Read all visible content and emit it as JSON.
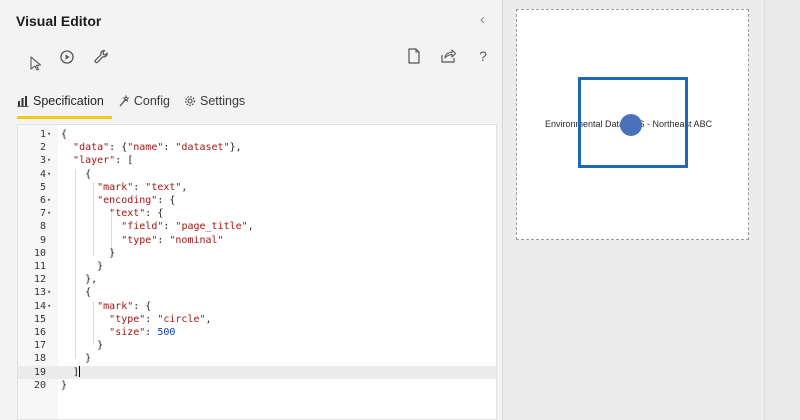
{
  "panel": {
    "title": "Visual Editor",
    "collapse_glyph": "‹"
  },
  "toolbar": {
    "left_icons": [
      "play-icon",
      "run-icon",
      "wrench-icon"
    ],
    "right_icons": [
      "new-file-icon",
      "share-icon",
      "help-icon"
    ],
    "help_glyph": "?"
  },
  "tabs": [
    {
      "label": "Specification",
      "icon": "bar-chart-icon",
      "active": true
    },
    {
      "label": "Config",
      "icon": "wand-icon",
      "active": false
    },
    {
      "label": "Settings",
      "icon": "gear-icon",
      "active": false
    }
  ],
  "editor": {
    "cursor_line": 19,
    "lines": [
      {
        "num": "1",
        "fold": "▾",
        "html": "{"
      },
      {
        "num": "2",
        "fold": "",
        "html": "  <span class='s'>\"data\"</span>: {<span class='s'>\"name\"</span>: <span class='s'>\"dataset\"</span>},"
      },
      {
        "num": "3",
        "fold": "▾",
        "html": "  <span class='s'>\"layer\"</span>: ["
      },
      {
        "num": "4",
        "fold": "▾",
        "html": "    {"
      },
      {
        "num": "5",
        "fold": "",
        "html": "      <span class='s'>\"mark\"</span>: <span class='s'>\"text\"</span>,"
      },
      {
        "num": "6",
        "fold": "▾",
        "html": "      <span class='s'>\"encoding\"</span>: {"
      },
      {
        "num": "7",
        "fold": "▾",
        "html": "        <span class='s'>\"text\"</span>: {"
      },
      {
        "num": "8",
        "fold": "",
        "html": "          <span class='s'>\"field\"</span>: <span class='s'>\"page_title\"</span>,"
      },
      {
        "num": "9",
        "fold": "",
        "html": "          <span class='s'>\"type\"</span>: <span class='s'>\"nominal\"</span>"
      },
      {
        "num": "10",
        "fold": "",
        "html": "        }"
      },
      {
        "num": "11",
        "fold": "",
        "html": "      }"
      },
      {
        "num": "12",
        "fold": "",
        "html": "    },"
      },
      {
        "num": "13",
        "fold": "▾",
        "html": "    {"
      },
      {
        "num": "14",
        "fold": "▾",
        "html": "      <span class='s'>\"mark\"</span>: {"
      },
      {
        "num": "15",
        "fold": "",
        "html": "        <span class='s'>\"type\"</span>: <span class='s'>\"circle\"</span>,"
      },
      {
        "num": "16",
        "fold": "",
        "html": "        <span class='s'>\"size\"</span>: <span class='n'>500</span>"
      },
      {
        "num": "17",
        "fold": "",
        "html": "      }"
      },
      {
        "num": "18",
        "fold": "",
        "html": "    }"
      },
      {
        "num": "19",
        "fold": "",
        "html": "  ]<span class='cursor'></span>"
      },
      {
        "num": "20",
        "fold": "",
        "html": "}"
      }
    ]
  },
  "preview": {
    "text": "Environmental Data - US - Northeast ABC",
    "circle_color": "#4a72ba",
    "highlight_color": "#1f67b8"
  },
  "colors": {
    "active_tab_underline": "#f2c811",
    "string": "#a31515",
    "number": "#0b3fa8"
  }
}
